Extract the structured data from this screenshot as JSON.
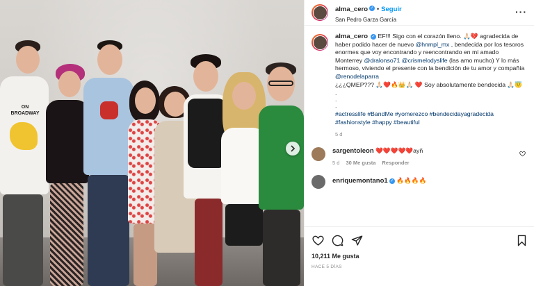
{
  "header": {
    "username": "alma_cero",
    "follow_label": "Seguir",
    "location": "San Pedro Garza García"
  },
  "caption": {
    "username": "alma_cero",
    "line1": "EF!!! Sigo con el corazón lleno. 🙏🏻💔 agradecida de haber podido hacer de nuevo ",
    "mention1": "@hnmpl_mx",
    "line2": " , bendecida por los tesoros enormes que voy encontrando y reencontrando en mi amado Monterrey ",
    "mention2": "@dralonso71",
    "mention3": "@crismelodyslife",
    "line3": " (las amo mucho) Y lo más hermoso, viviendo el presente con la bendición de tu amor y compañía ",
    "mention4": "@renodelaparra",
    "line4": "¿¿¿QMEP??? 🙏🏻❤️🔥👑🙏🏻 ❤️ Soy absolutamente bendecida 🙏🏻😇",
    "dots": ".\n.\n.",
    "hashtags": "#actresslife #BandMe #yomerezco #bendecidayagradecida #fashionstyle #happy #beautiful",
    "age": "5 d"
  },
  "comments": [
    {
      "username": "sargentoleon",
      "text": "❤️❤️❤️❤️❤️ayñ",
      "age": "5 d",
      "likes": "30 Me gusta",
      "reply": "Responder"
    },
    {
      "username": "enriquemontano1",
      "text": "🔥🔥🔥🔥"
    }
  ],
  "actions": {
    "likes": "10,211 Me gusta",
    "posted": "HACE 5 DÍAS"
  },
  "photo": {
    "shirt_text": "ON BROADWAY"
  },
  "colors": {
    "link": "#00376b",
    "follow": "#0095f6",
    "muted": "#8e8e8e"
  }
}
